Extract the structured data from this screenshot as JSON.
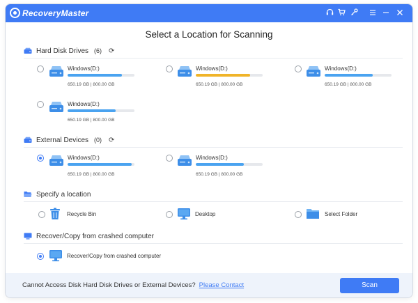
{
  "app": {
    "title": "RecoveryMaster"
  },
  "titlebar": {
    "icons": [
      "headset-icon",
      "cart-icon",
      "key-icon",
      "menu-icon",
      "minimize-icon",
      "close-icon"
    ]
  },
  "page_title": "Select a Location for Scanning",
  "hard_disk": {
    "label": "Hard Disk Drives",
    "count": "(6)",
    "drives": [
      {
        "name": "Windows(D:)",
        "used": "650.19 GB",
        "total": "800.00 GB",
        "fill": 0.81,
        "color": "#4aa3f0",
        "selected": false
      },
      {
        "name": "Windows(D:)",
        "used": "650.19 GB",
        "total": "800.00 GB",
        "fill": 0.81,
        "color": "#f0b429",
        "selected": false
      },
      {
        "name": "Windows(D:)",
        "used": "650.19 GB",
        "total": "800.00 GB",
        "fill": 0.72,
        "color": "#4aa3f0",
        "selected": false
      },
      {
        "name": "Windows(D:)",
        "used": "650.19 GB",
        "total": "800.00 GB",
        "fill": 0.72,
        "color": "#4aa3f0",
        "selected": false
      }
    ]
  },
  "external": {
    "label": "External Devices",
    "count": "(0)",
    "drives": [
      {
        "name": "Windows(D:)",
        "used": "650.19 GB",
        "total": "800.00 GB",
        "fill": 0.96,
        "color": "#4aa3f0",
        "selected": true
      },
      {
        "name": "Windows(D:)",
        "used": "650.19 GB",
        "total": "800.00 GB",
        "fill": 0.72,
        "color": "#4aa3f0",
        "selected": false
      }
    ]
  },
  "specify": {
    "label": "Specify a location",
    "items": [
      {
        "label": "Recycle Bin",
        "icon": "recycle-bin-icon"
      },
      {
        "label": "Desktop",
        "icon": "desktop-icon"
      },
      {
        "label": "Select Folder",
        "icon": "folder-icon"
      }
    ]
  },
  "crashed": {
    "label": "Recover/Copy from crashed computer",
    "item_label": "Recover/Copy from crashed computer"
  },
  "footer": {
    "text": "Cannot Access Disk Hard Disk Drives or External Devices?",
    "link": "Please Contact",
    "scan_label": "Scan"
  },
  "colors": {
    "accent": "#3f7bf5",
    "bar_blue": "#4aa3f0",
    "bar_yellow": "#f0b429"
  }
}
